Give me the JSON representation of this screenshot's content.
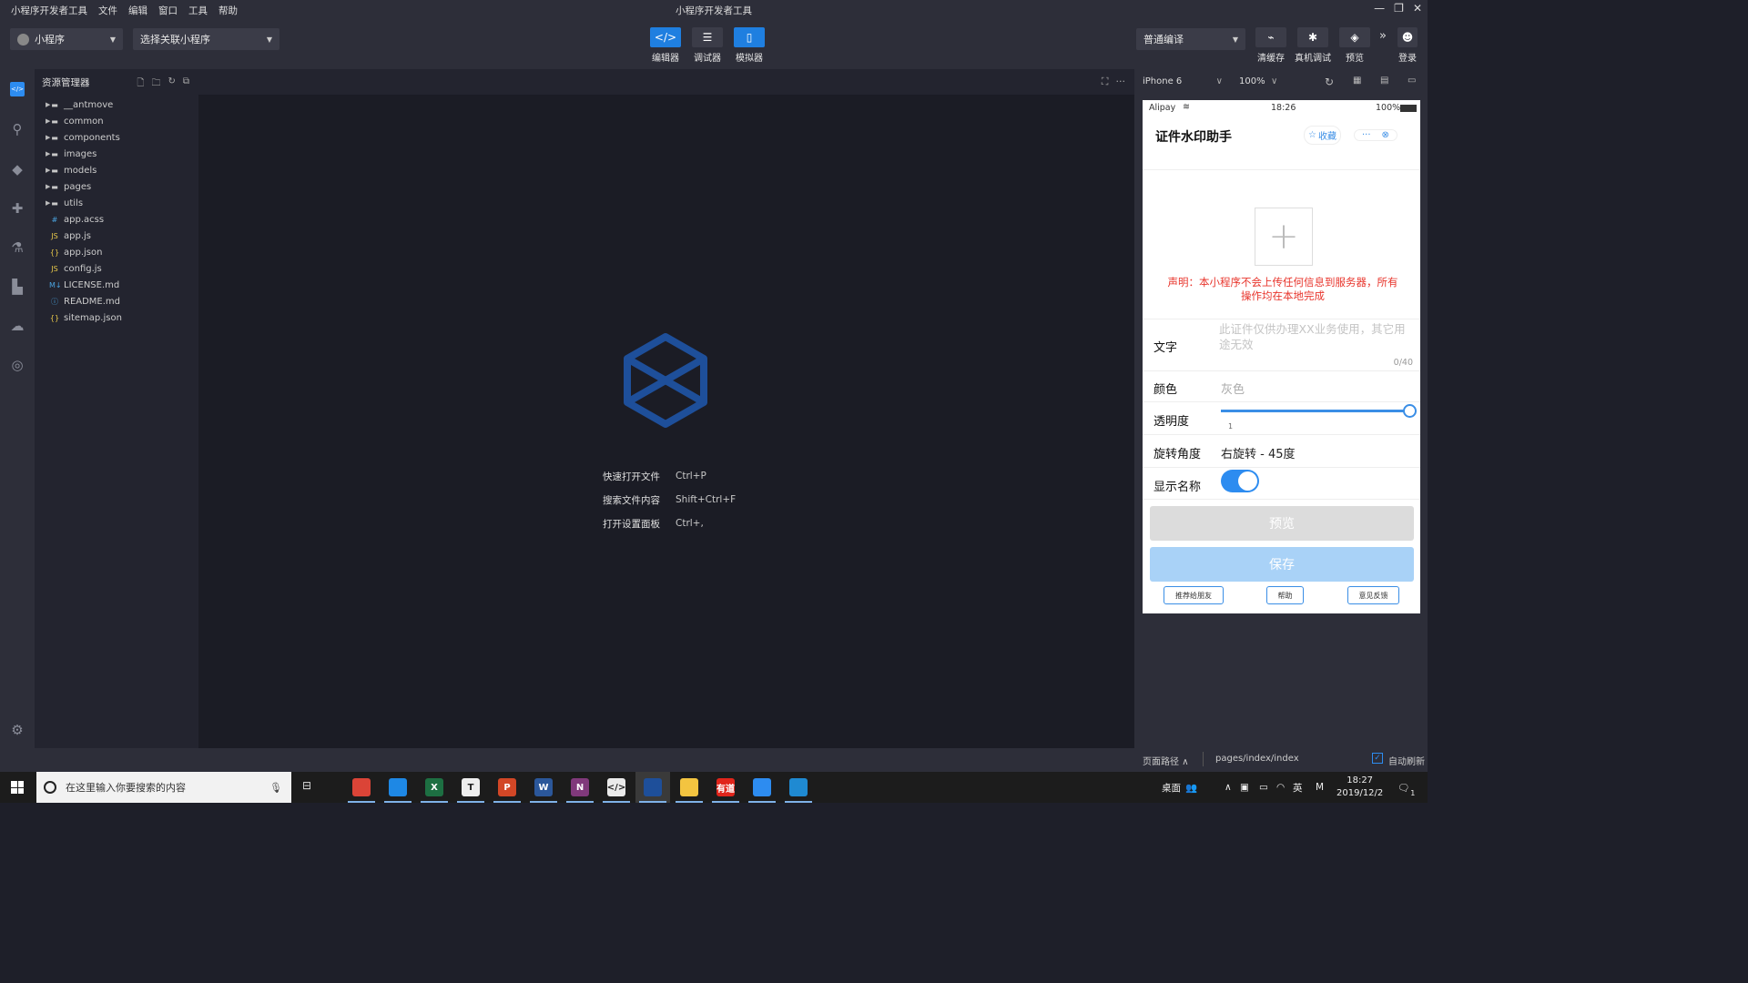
{
  "titlebar": {
    "menu": [
      "小程序开发者工具",
      "文件",
      "编辑",
      "窗口",
      "工具",
      "帮助"
    ],
    "title": "小程序开发者工具"
  },
  "toolbar": {
    "project_select": "小程序",
    "related_select": "选择关联小程序",
    "editor_label": "编辑器",
    "debugger_label": "调试器",
    "simulator_label": "模拟器",
    "compile_mode": "普通编译",
    "clear_cache_label": "清缓存",
    "device_debug_label": "真机调试",
    "preview_label": "预览",
    "login_label": "登录",
    "more_icon": "»"
  },
  "explorer": {
    "title": "资源管理器",
    "folders": [
      "__antmove",
      "common",
      "components",
      "images",
      "models",
      "pages",
      "utils"
    ],
    "files": [
      {
        "name": "app.acss",
        "type": "#",
        "color": "#4aa3df"
      },
      {
        "name": "app.js",
        "type": "JS",
        "color": "#e8c84a"
      },
      {
        "name": "app.json",
        "type": "{}",
        "color": "#e8c84a"
      },
      {
        "name": "config.js",
        "type": "JS",
        "color": "#e8c84a"
      },
      {
        "name": "LICENSE.md",
        "type": "M↓",
        "color": "#4aa3df"
      },
      {
        "name": "README.md",
        "type": "ⓘ",
        "color": "#4aa3df"
      },
      {
        "name": "sitemap.json",
        "type": "{}",
        "color": "#e8c84a"
      }
    ]
  },
  "editor": {
    "shortcuts": [
      {
        "name": "快速打开文件",
        "key": "Ctrl+P"
      },
      {
        "name": "搜索文件内容",
        "key": "Shift+Ctrl+F"
      },
      {
        "name": "打开设置面板",
        "key": "Ctrl+,"
      }
    ]
  },
  "simulator": {
    "device": "iPhone 6",
    "zoom": "100%",
    "status": {
      "carrier": "Alipay",
      "time": "18:26",
      "battery": "100%"
    },
    "nav_title": "证件水印助手",
    "favorite_label": "收藏",
    "more_label": "···",
    "notice": "声明：本小程序不会上传任何信息到服务器，所有操作均在本地完成",
    "text_label": "文字",
    "text_placeholder": "此证件仅供办理XX业务使用，其它用途无效",
    "text_count": "0/40",
    "color_label": "颜色",
    "color_value": "灰色",
    "opacity_label": "透明度",
    "opacity_value": "1",
    "opacity_fraction": 1.0,
    "rotation_label": "旋转角度",
    "rotation_value": "右旋转 - 45度",
    "show_name_label": "显示名称",
    "show_name_on": true,
    "preview_btn": "预览",
    "save_btn": "保存",
    "link_recommend": "推荐给朋友",
    "link_help": "帮助",
    "link_feedback": "意见反馈"
  },
  "statusbar": {
    "page_path_label": "页面路径",
    "page_path": "pages/index/index",
    "auto_refresh": "自动刷新"
  },
  "taskbar": {
    "search_placeholder": "在这里输入你要搜索的内容",
    "apps": [
      {
        "name": "chrome",
        "label": "",
        "color": "#db4437"
      },
      {
        "name": "shield",
        "label": "",
        "color": "#1e88e5"
      },
      {
        "name": "excel",
        "label": "X",
        "color": "#1d6f42"
      },
      {
        "name": "typora",
        "label": "T",
        "color": "#eeeeee"
      },
      {
        "name": "powerpoint",
        "label": "P",
        "color": "#d24726"
      },
      {
        "name": "word",
        "label": "W",
        "color": "#2b579a"
      },
      {
        "name": "onenote",
        "label": "N",
        "color": "#80397b"
      },
      {
        "name": "devtools",
        "label": "</>",
        "color": "#eaeaea"
      },
      {
        "name": "miniapp-ide",
        "label": "",
        "color": "#1e4f9a"
      },
      {
        "name": "explorer",
        "label": "",
        "color": "#f3c440"
      },
      {
        "name": "youdao",
        "label": "有道",
        "color": "#e1251b"
      },
      {
        "name": "feishu",
        "label": "",
        "color": "#2d8cf0"
      },
      {
        "name": "vscode",
        "label": "",
        "color": "#1f8ad2"
      }
    ],
    "desktop_label": "桌面",
    "ime_cn": "英",
    "ime_m": "M",
    "time": "18:27",
    "date": "2019/12/2",
    "notification_count": "1"
  },
  "colors": {
    "accent": "#1f7fe0",
    "danger": "#e8342b",
    "switch": "#2d8cf0"
  }
}
